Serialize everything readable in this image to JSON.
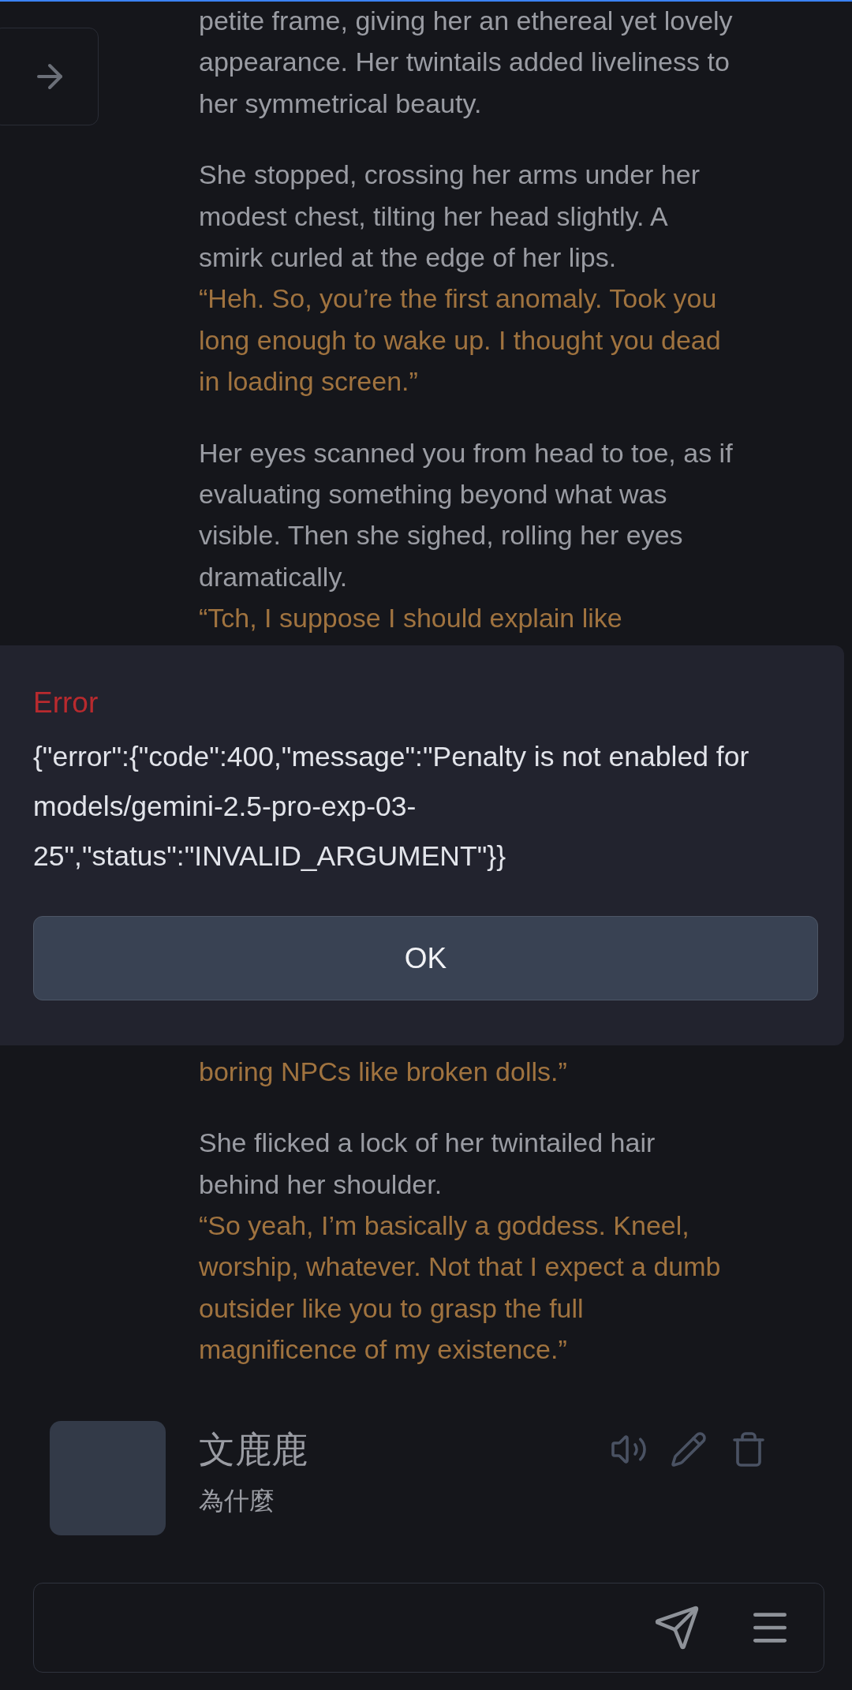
{
  "story": {
    "top": [
      {
        "segments": [
          {
            "kind": "narration",
            "text": "petite frame, giving her an ethereal yet lovely appearance. Her twintails added liveliness to her symmetrical beauty."
          }
        ]
      },
      {
        "segments": [
          {
            "kind": "narration",
            "text": "She stopped, crossing her arms under her modest chest, tilting her head slightly. A smirk curled at the edge of her lips."
          },
          {
            "kind": "dialogue",
            "text": "“Heh. So, you’re the first anomaly. Took you long enough to wake up. I thought you dead in loading screen.”"
          }
        ]
      },
      {
        "segments": [
          {
            "kind": "narration",
            "text": "Her eyes scanned you from head to toe, as if evaluating something beyond what was visible. Then she sighed, rolling her eyes dramatically."
          },
          {
            "kind": "dialogue",
            "text": "“Tch, I suppose I should explain like"
          }
        ]
      }
    ],
    "bottom": [
      {
        "segments": [
          {
            "kind": "dialogue",
            "text": "boring NPCs like broken dolls.”"
          }
        ]
      },
      {
        "segments": [
          {
            "kind": "narration",
            "text": "She flicked a lock of her twintailed hair behind her shoulder."
          },
          {
            "kind": "dialogue",
            "text": "“So yeah, I’m basically a goddess. Kneel, worship, whatever. Not that I expect a dumb outsider like you to grasp the full magnificence of my existence.”"
          }
        ]
      }
    ]
  },
  "user_message": {
    "name": "文鹿鹿",
    "text": "為什麼"
  },
  "dialog": {
    "title": "Error",
    "message": "{\"error\":{\"code\":400,\"message\":\"Penalty is not enabled for models/gemini-2.5-pro-exp-03-25\",\"status\":\"INVALID_ARGUMENT\"}}",
    "button": "OK"
  }
}
